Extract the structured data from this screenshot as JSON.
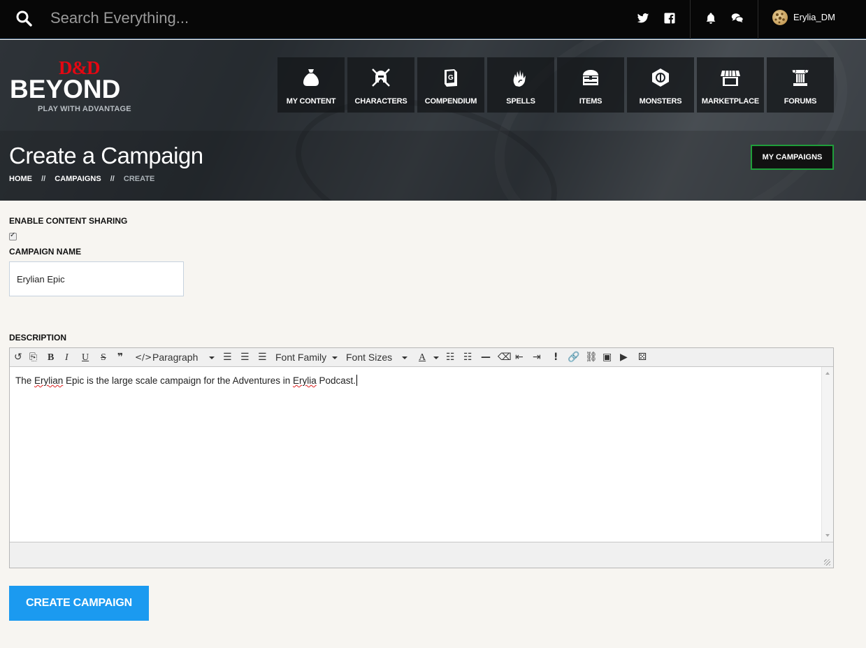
{
  "topbar": {
    "search_placeholder": "Search Everything...",
    "username": "Erylia_DM"
  },
  "logo": {
    "mark": "D&D",
    "wordmark": "BEYOND",
    "tagline": "PLAY WITH ADVANTAGE"
  },
  "nav": {
    "items": [
      {
        "label": "MY CONTENT",
        "icon": "bag-icon"
      },
      {
        "label": "CHARACTERS",
        "icon": "helmet-icon"
      },
      {
        "label": "COMPENDIUM",
        "icon": "book-icon"
      },
      {
        "label": "SPELLS",
        "icon": "hand-flame-icon"
      },
      {
        "label": "ITEMS",
        "icon": "chest-icon"
      },
      {
        "label": "MONSTERS",
        "icon": "monster-icon"
      },
      {
        "label": "MARKETPLACE",
        "icon": "shop-icon"
      },
      {
        "label": "FORUMS",
        "icon": "pillar-icon"
      }
    ]
  },
  "page": {
    "title": "Create a Campaign",
    "breadcrumbs": [
      "HOME",
      "//",
      "CAMPAIGNS",
      "//",
      "CREATE"
    ],
    "my_campaigns_label": "MY CAMPAIGNS"
  },
  "form": {
    "content_sharing_label": "ENABLE CONTENT SHARING",
    "campaign_name_label": "CAMPAIGN NAME",
    "campaign_name_value": "Erylian Epic",
    "description_label": "DESCRIPTION",
    "toolbar": {
      "paragraph": "Paragraph",
      "font_family": "Font Family",
      "font_sizes": "Font Sizes"
    },
    "description_parts": [
      "The ",
      "Erylian",
      " Epic is the large scale campaign for the Adventures in ",
      "Erylia",
      " Podcast."
    ],
    "submit_label": "CREATE CAMPAIGN"
  }
}
